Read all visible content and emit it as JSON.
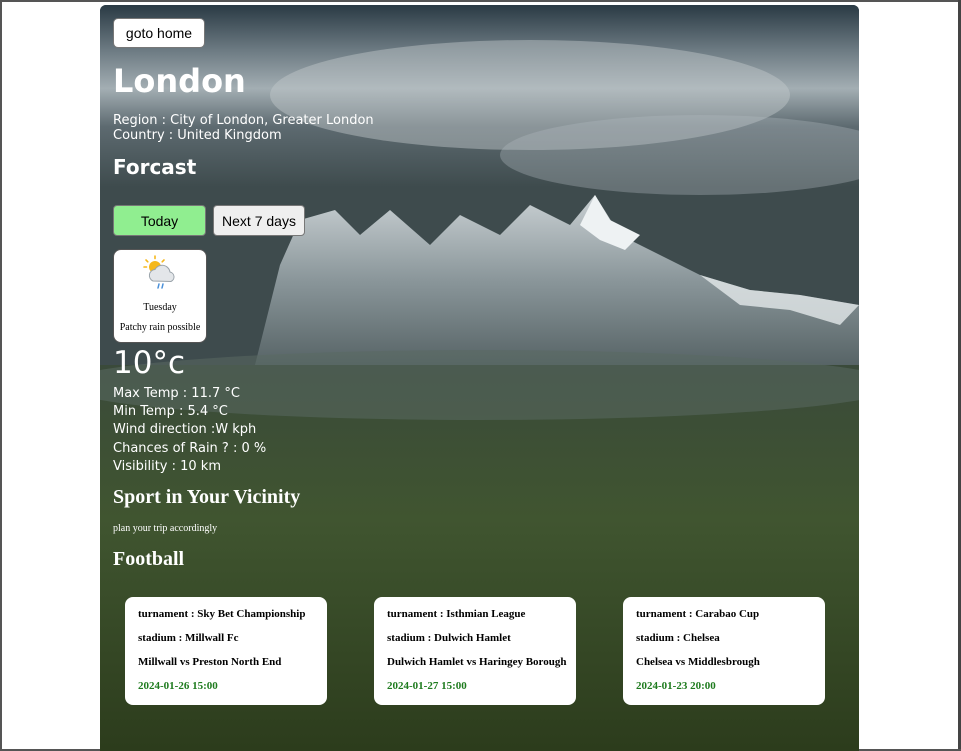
{
  "nav": {
    "home_label": "goto home"
  },
  "location": {
    "city": "London",
    "region_line": "Region : City of London, Greater London",
    "country_line": "Country : United Kingdom"
  },
  "forecast": {
    "heading": "Forcast",
    "tabs": [
      {
        "label": "Today",
        "active": true
      },
      {
        "label": "Next 7 days",
        "active": false
      }
    ],
    "day": {
      "icon": "partly-cloudy-rain-icon",
      "name": "Tuesday",
      "condition": "Patchy rain possible"
    },
    "temperature": "10°c",
    "stats": [
      "Max Temp : 11.7 °C",
      "Min Temp : 5.4 °C",
      "Wind direction :W kph",
      "Chances of Rain ? : 0 %",
      "Visibility : 10 km"
    ]
  },
  "sport": {
    "heading": "Sport in Your Vicinity",
    "hint": "plan your trip accordingly",
    "football_heading": "Football",
    "matches": [
      {
        "tournament": "turnament : Sky Bet Championship",
        "stadium": "stadium : Millwall Fc",
        "teams": "Millwall vs Preston North End",
        "datetime": "2024-01-26 15:00"
      },
      {
        "tournament": "turnament : Isthmian League",
        "stadium": "stadium : Dulwich Hamlet",
        "teams": "Dulwich Hamlet vs Haringey Borough",
        "datetime": "2024-01-27 15:00"
      },
      {
        "tournament": "turnament : Carabao Cup",
        "stadium": "stadium : Chelsea",
        "teams": "Chelsea vs Middlesbrough",
        "datetime": "2024-01-23 20:00"
      }
    ]
  },
  "colors": {
    "active_tab": "#90ee90",
    "match_datetime": "#1e7b1e"
  }
}
